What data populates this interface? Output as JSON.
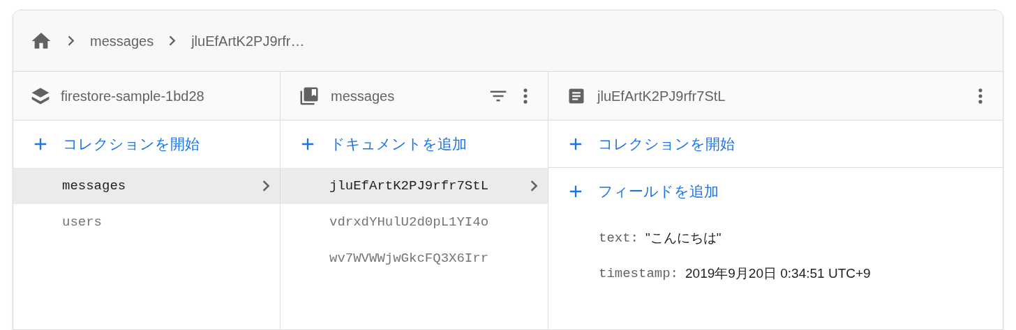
{
  "breadcrumb": {
    "items": [
      "messages",
      "jluEfArtK2PJ9rfr…"
    ]
  },
  "panels": [
    {
      "kind": "project",
      "title": "firestore-sample-1bd28",
      "actions": [
        "コレクションを開始"
      ],
      "items": [
        {
          "label": "messages",
          "selected": true
        },
        {
          "label": "users",
          "selected": false
        }
      ]
    },
    {
      "kind": "collection",
      "title": "messages",
      "actions": [
        "ドキュメントを追加"
      ],
      "items": [
        {
          "label": "jluEfArtK2PJ9rfr7StL",
          "selected": true
        },
        {
          "label": "vdrxdYHulU2d0pL1YI4o",
          "selected": false
        },
        {
          "label": "wv7WVWWjwGkcFQ3X6Irr",
          "selected": false
        }
      ]
    },
    {
      "kind": "document",
      "title": "jluEfArtK2PJ9rfr7StL",
      "actions": [
        "コレクションを開始",
        "フィールドを追加"
      ],
      "fields": [
        {
          "key": "text:",
          "value": "\"こんにちは\""
        },
        {
          "key": "timestamp:",
          "value": "2019年9月20日 0:34:51 UTC+9"
        }
      ]
    }
  ]
}
